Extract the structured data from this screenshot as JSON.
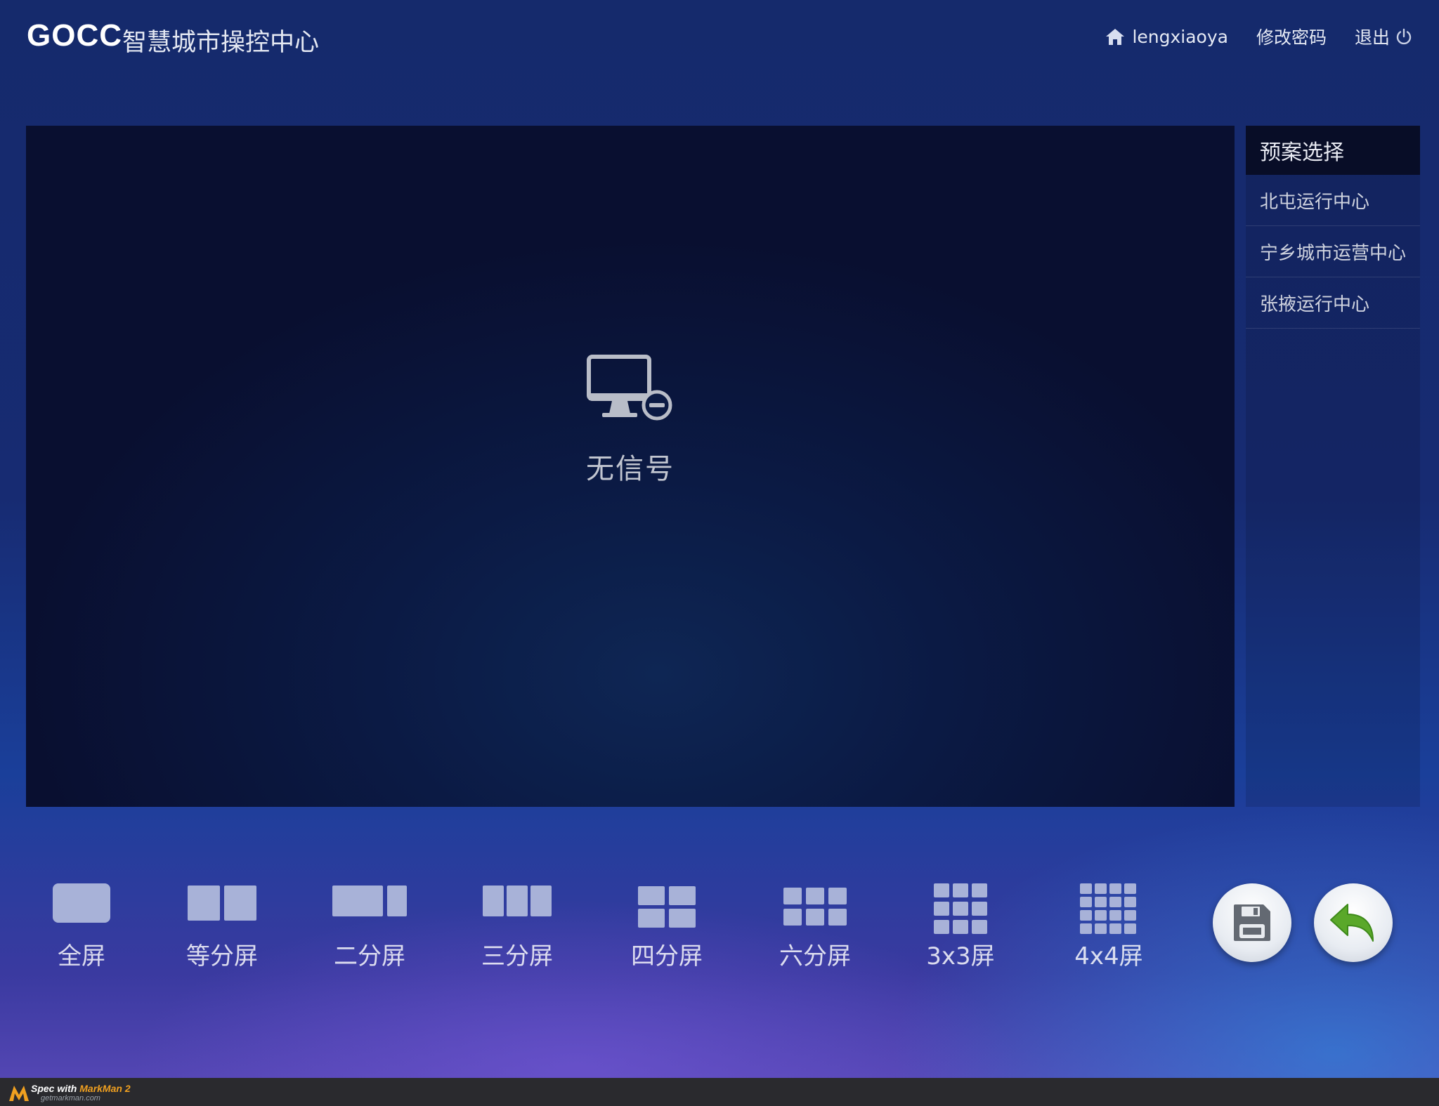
{
  "header": {
    "logo": "GOCC",
    "title": "智慧城市操控中心",
    "username": "lengxiaoya",
    "change_password": "修改密码",
    "logout": "退出"
  },
  "screen": {
    "status_label": "无信号",
    "icon": "monitor-disconnected-icon"
  },
  "plan_panel": {
    "title": "预案选择",
    "items": [
      "北屯运行中心",
      "宁乡城市运营中心",
      "张掖运行中心"
    ]
  },
  "layouts": [
    {
      "label": "全屏",
      "icon": "fullscreen-layout-icon"
    },
    {
      "label": "等分屏",
      "icon": "equal-split-layout-icon"
    },
    {
      "label": "二分屏",
      "icon": "two-split-layout-icon"
    },
    {
      "label": "三分屏",
      "icon": "three-split-layout-icon"
    },
    {
      "label": "四分屏",
      "icon": "four-split-layout-icon"
    },
    {
      "label": "六分屏",
      "icon": "six-split-layout-icon"
    },
    {
      "label": "3x3屏",
      "icon": "grid-3x3-layout-icon"
    },
    {
      "label": "4x4屏",
      "icon": "grid-4x4-layout-icon"
    }
  ],
  "actions": {
    "save_icon": "floppy-save-icon",
    "back_icon": "undo-arrow-icon"
  },
  "footer": {
    "spec_prefix": "Spec with",
    "spec_brand": "MarkMan 2",
    "site": "getmarkman.com"
  },
  "colors": {
    "panel_head_bg": "#080d27",
    "layout_block": "#a8b2d8",
    "back_arrow": "#5aa82a"
  }
}
